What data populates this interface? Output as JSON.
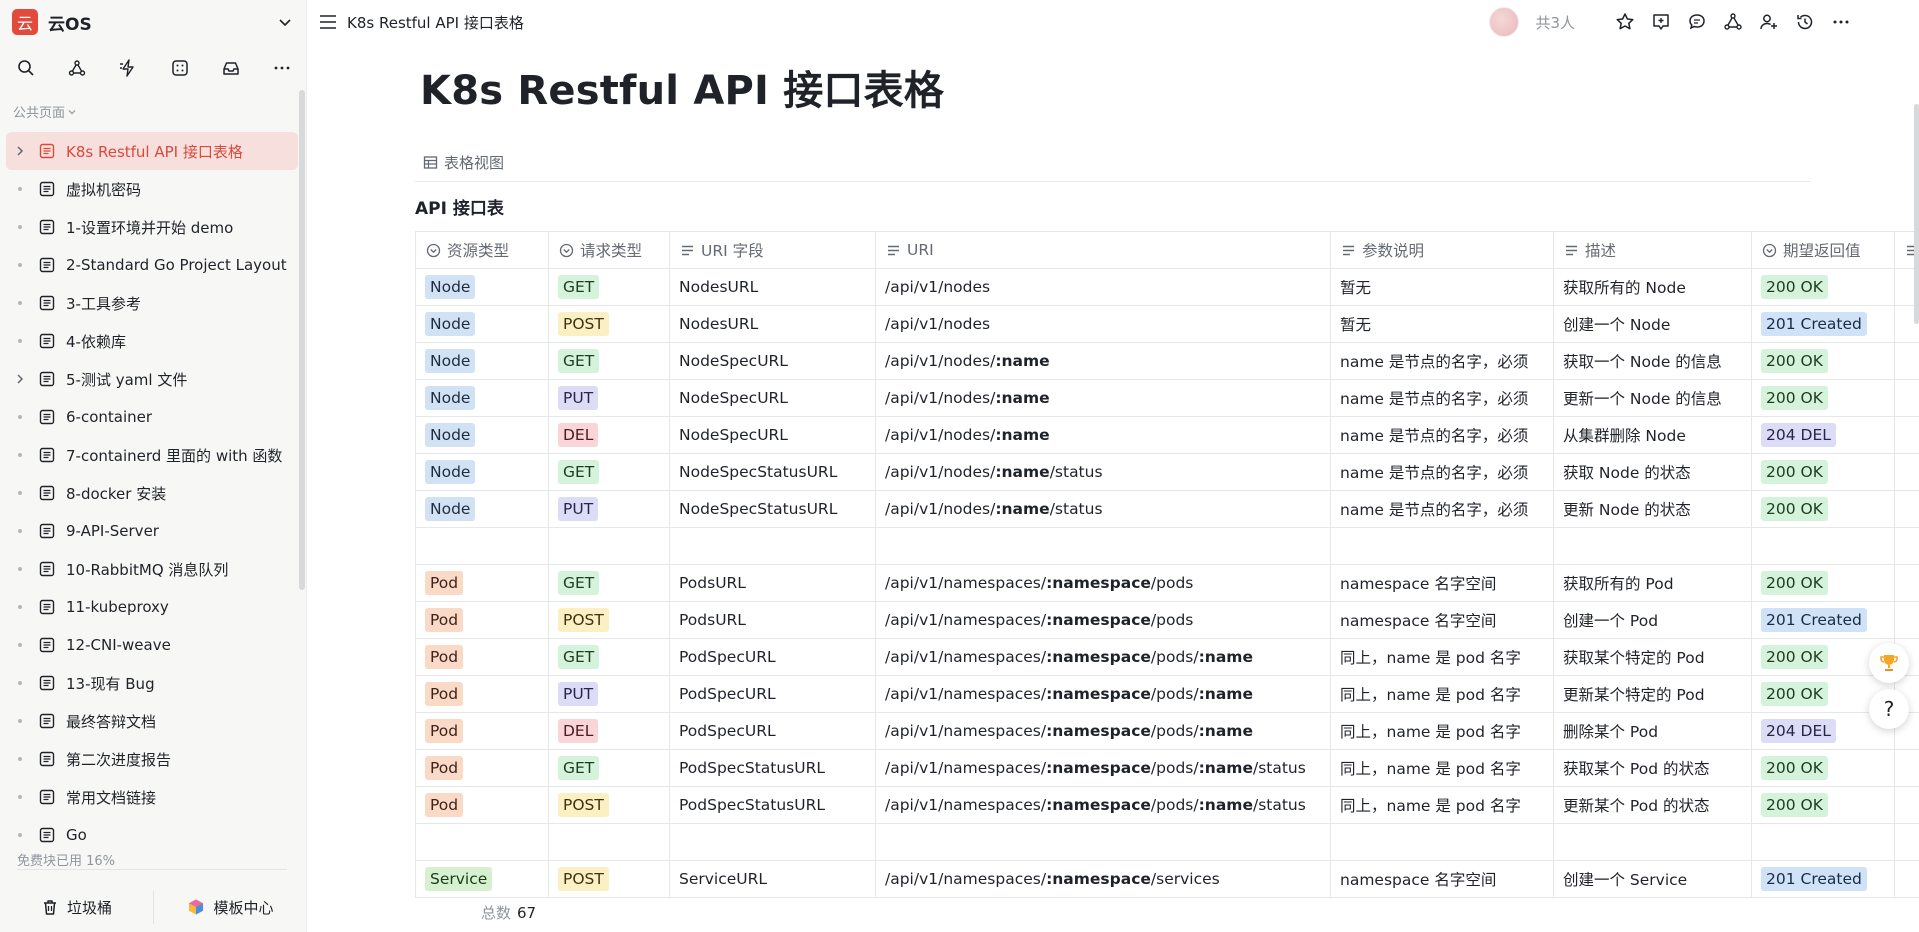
{
  "workspace": {
    "logo_char": "云",
    "name": "云OS"
  },
  "sidebar": {
    "section_label": "公共页面",
    "items": [
      {
        "label": "K8s Restful API 接口表格",
        "active": true,
        "expandable": true
      },
      {
        "label": "虚拟机密码"
      },
      {
        "label": "1-设置环境并开始 demo"
      },
      {
        "label": "2-Standard Go Project Layout"
      },
      {
        "label": "3-工具参考"
      },
      {
        "label": "4-依赖库"
      },
      {
        "label": "5-测试 yaml 文件",
        "expandable": true
      },
      {
        "label": "6-container"
      },
      {
        "label": "7-containerd 里面的 with 函数"
      },
      {
        "label": "8-docker 安装"
      },
      {
        "label": "9-API-Server"
      },
      {
        "label": "10-RabbitMQ 消息队列"
      },
      {
        "label": "11-kubeproxy"
      },
      {
        "label": "12-CNI-weave"
      },
      {
        "label": "13-现有 Bug"
      },
      {
        "label": "最终答辩文档"
      },
      {
        "label": "第二次进度报告"
      },
      {
        "label": "常用文档链接"
      },
      {
        "label": "Go"
      }
    ],
    "quota_text": "免费块已用 16%",
    "quota_percent": 16,
    "trash_label": "垃圾桶",
    "templates_label": "模板中心"
  },
  "topbar": {
    "breadcrumb": "K8s Restful API 接口表格",
    "people_count": "共3人"
  },
  "page": {
    "title": "K8s Restful API 接口表格",
    "view_tab": "表格视图",
    "table_title": "API 接口表",
    "total_label": "总数",
    "total_value": "67"
  },
  "table": {
    "columns": [
      "资源类型",
      "请求类型",
      "URI 字段",
      "URI",
      "参数说明",
      "描述",
      "期望返回值"
    ],
    "rows": [
      {
        "resource": "Node",
        "method": "GET",
        "field": "NodesURL",
        "uri": [
          [
            "/api/v1/nodes",
            false
          ]
        ],
        "param": "暂无",
        "desc": "获取所有的 Node",
        "status": "200 OK"
      },
      {
        "resource": "Node",
        "method": "POST",
        "field": "NodesURL",
        "uri": [
          [
            "/api/v1/nodes",
            false
          ]
        ],
        "param": "暂无",
        "desc": "创建一个 Node",
        "status": "201 Created"
      },
      {
        "resource": "Node",
        "method": "GET",
        "field": "NodeSpecURL",
        "uri": [
          [
            "/api/v1/nodes/",
            false
          ],
          [
            ":name",
            true
          ]
        ],
        "param": "name 是节点的名字，必须",
        "desc": "获取一个 Node 的信息",
        "status": "200 OK"
      },
      {
        "resource": "Node",
        "method": "PUT",
        "field": "NodeSpecURL",
        "uri": [
          [
            "/api/v1/nodes/",
            false
          ],
          [
            ":name",
            true
          ]
        ],
        "param": "name 是节点的名字，必须",
        "desc": "更新一个 Node 的信息",
        "status": "200 OK"
      },
      {
        "resource": "Node",
        "method": "DEL",
        "field": "NodeSpecURL",
        "uri": [
          [
            "/api/v1/nodes/",
            false
          ],
          [
            ":name",
            true
          ]
        ],
        "param": "name 是节点的名字，必须",
        "desc": "从集群删除 Node",
        "status": "204 DEL"
      },
      {
        "resource": "Node",
        "method": "GET",
        "field": "NodeSpecStatusURL",
        "uri": [
          [
            "/api/v1/nodes/",
            false
          ],
          [
            ":name",
            true
          ],
          [
            "/status",
            false
          ]
        ],
        "param": "name 是节点的名字，必须",
        "desc": "获取 Node 的状态",
        "status": "200 OK"
      },
      {
        "resource": "Node",
        "method": "PUT",
        "field": "NodeSpecStatusURL",
        "uri": [
          [
            "/api/v1/nodes/",
            false
          ],
          [
            ":name",
            true
          ],
          [
            "/status",
            false
          ]
        ],
        "param": "name 是节点的名字，必须",
        "desc": "更新 Node 的状态",
        "status": "200 OK"
      },
      {
        "empty": true
      },
      {
        "resource": "Pod",
        "method": "GET",
        "field": "PodsURL",
        "uri": [
          [
            "/api/v1/namespaces/",
            false
          ],
          [
            ":namespace",
            true
          ],
          [
            "/pods",
            false
          ]
        ],
        "param": "namespace 名字空间",
        "desc": "获取所有的 Pod",
        "status": "200 OK"
      },
      {
        "resource": "Pod",
        "method": "POST",
        "field": "PodsURL",
        "uri": [
          [
            "/api/v1/namespaces/",
            false
          ],
          [
            ":namespace",
            true
          ],
          [
            "/pods",
            false
          ]
        ],
        "param": "namespace 名字空间",
        "desc": "创建一个 Pod",
        "status": "201 Created"
      },
      {
        "resource": "Pod",
        "method": "GET",
        "field": "PodSpecURL",
        "uri": [
          [
            "/api/v1/namespaces/",
            false
          ],
          [
            ":namespace",
            true
          ],
          [
            "/pods/",
            false
          ],
          [
            ":name",
            true
          ]
        ],
        "param": "同上，name 是 pod 名字",
        "desc": "获取某个特定的 Pod",
        "status": "200 OK"
      },
      {
        "resource": "Pod",
        "method": "PUT",
        "field": "PodSpecURL",
        "uri": [
          [
            "/api/v1/namespaces/",
            false
          ],
          [
            ":namespace",
            true
          ],
          [
            "/pods/",
            false
          ],
          [
            ":name",
            true
          ]
        ],
        "param": "同上，name 是 pod 名字",
        "desc": "更新某个特定的 Pod",
        "status": "200 OK"
      },
      {
        "resource": "Pod",
        "method": "DEL",
        "field": "PodSpecURL",
        "uri": [
          [
            "/api/v1/namespaces/",
            false
          ],
          [
            ":namespace",
            true
          ],
          [
            "/pods/",
            false
          ],
          [
            ":name",
            true
          ]
        ],
        "param": "同上，name 是 pod 名字",
        "desc": "删除某个 Pod",
        "status": "204 DEL"
      },
      {
        "resource": "Pod",
        "method": "GET",
        "field": "PodSpecStatusURL",
        "uri": [
          [
            "/api/v1/namespaces/",
            false
          ],
          [
            ":namespace",
            true
          ],
          [
            "/pods/",
            false
          ],
          [
            ":name",
            true
          ],
          [
            "/status",
            false
          ]
        ],
        "param": "同上，name 是 pod 名字",
        "desc": "获取某个 Pod 的状态",
        "status": "200 OK"
      },
      {
        "resource": "Pod",
        "method": "POST",
        "field": "PodSpecStatusURL",
        "uri": [
          [
            "/api/v1/namespaces/",
            false
          ],
          [
            ":namespace",
            true
          ],
          [
            "/pods/",
            false
          ],
          [
            ":name",
            true
          ],
          [
            "/status",
            false
          ]
        ],
        "param": "同上，name 是 pod 名字",
        "desc": "更新某个 Pod 的状态",
        "status": "200 OK"
      },
      {
        "empty": true
      },
      {
        "resource": "Service",
        "method": "POST",
        "field": "ServiceURL",
        "uri": [
          [
            "/api/v1/namespaces/",
            false
          ],
          [
            ":namespace",
            true
          ],
          [
            "/services",
            false
          ]
        ],
        "param": "namespace 名字空间",
        "desc": "创建一个 Service",
        "status": "201 Created"
      }
    ]
  },
  "colors": {
    "brand": "#e34a3b",
    "active_bg": "#f7dfdd",
    "active_text": "#d94a3c"
  }
}
